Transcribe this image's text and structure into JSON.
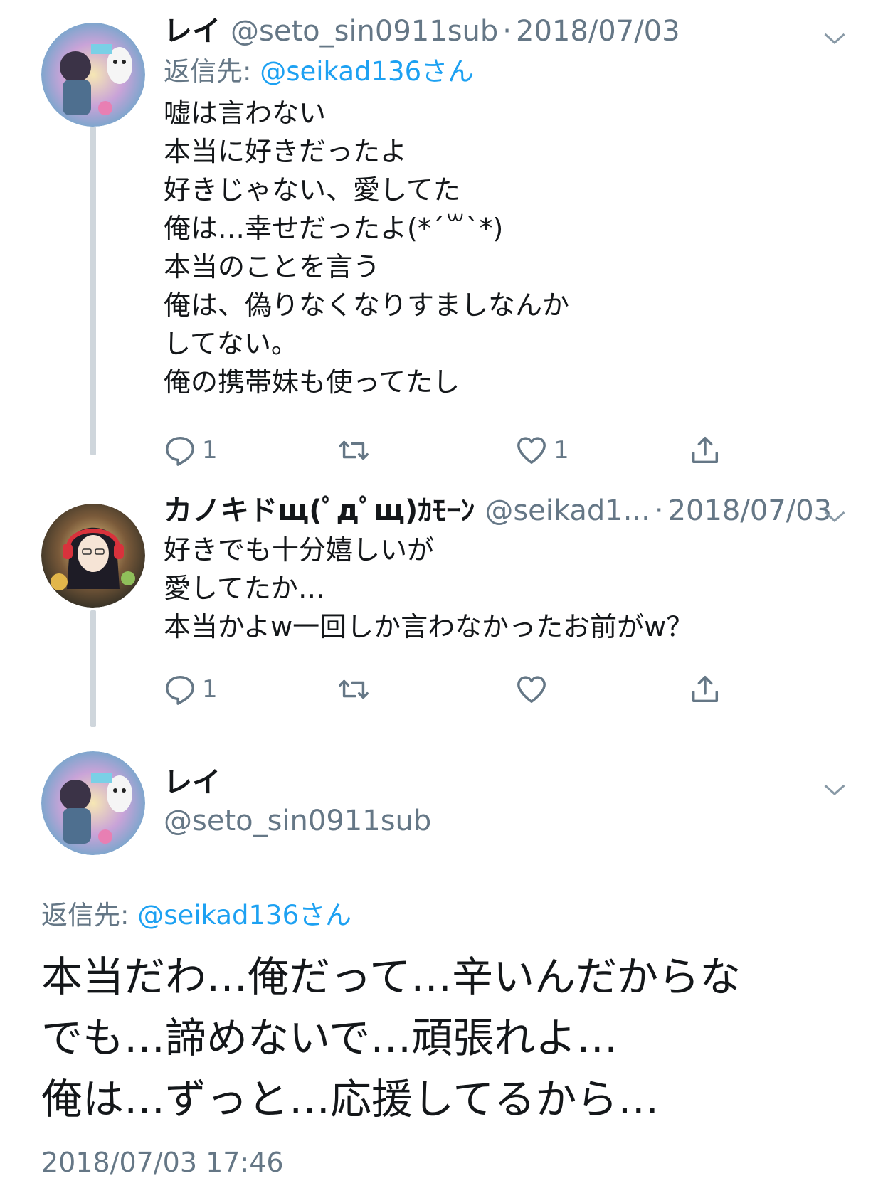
{
  "tweets": [
    {
      "name": "レイ",
      "handle": "@seto_sin0911sub",
      "separator": "·",
      "date": "2018/07/03",
      "reply_label": "返信先: ",
      "reply_mention": "@seikad136さん",
      "lines": [
        "嘘は言わない",
        "本当に好きだったよ",
        "好きじゃない、愛してた",
        "俺は…幸せだったよ(*´꒳`*)",
        "本当のことを言う",
        "俺は、偽りなくなりすましなんか",
        "してない。",
        "俺の携帯妹も使ってたし"
      ],
      "actions": {
        "reply_count": "1",
        "retweet_count": "",
        "like_count": "1"
      }
    },
    {
      "name": "カノキドщ(ﾟдﾟщ)ｶﾓｰﾝ",
      "handle": "@seikad1...",
      "separator": "·",
      "date": "2018/07/03",
      "lines": [
        "好きでも十分嬉しいが",
        "愛してたか…",
        "本当かよw一回しか言わなかったお前がw？"
      ],
      "actions": {
        "reply_count": "1",
        "retweet_count": "",
        "like_count": ""
      }
    }
  ],
  "main_tweet": {
    "name": "レイ",
    "handle": "@seto_sin0911sub",
    "reply_label": "返信先: ",
    "reply_mention": "@seikad136さん",
    "lines": [
      "本当だわ…俺だって…辛いんだからな",
      "でも…諦めないで…頑張れよ…",
      "俺は…ずっと…応援してるから…"
    ],
    "timestamp": "2018/07/03 17:46"
  },
  "colors": {
    "link": "#1da1f2",
    "secondary_text": "#657786",
    "primary_text": "#14171a",
    "thread_line": "#cfd6dc"
  },
  "icons": [
    "reply-icon",
    "retweet-icon",
    "like-icon",
    "share-icon",
    "chevron-down-icon"
  ]
}
